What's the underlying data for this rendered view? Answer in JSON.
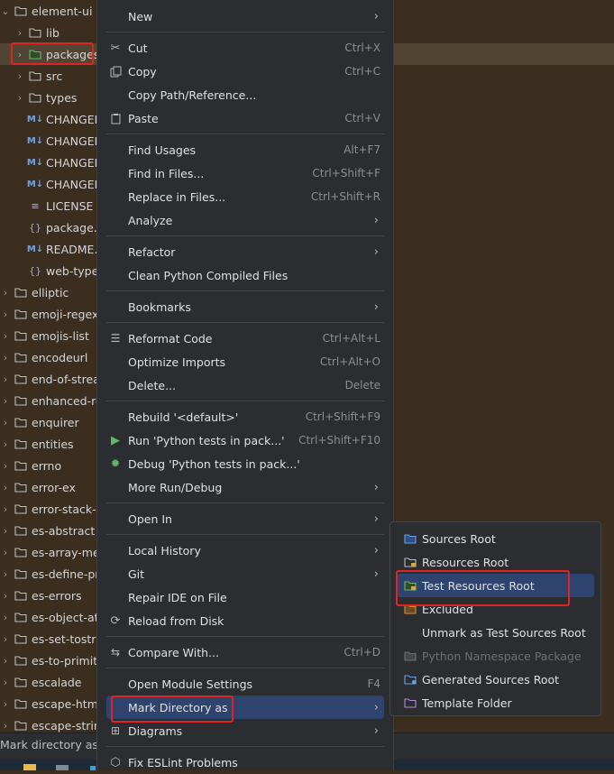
{
  "project_tree": {
    "items": [
      {
        "label": "element-ui",
        "icon": "folder-icon",
        "chevron": "down",
        "level": 0
      },
      {
        "label": "lib",
        "icon": "folder-icon",
        "chevron": "right",
        "level": 1
      },
      {
        "label": "packages",
        "icon": "folder-green-icon",
        "chevron": "right",
        "level": 1
      },
      {
        "label": "src",
        "icon": "folder-icon",
        "chevron": "right",
        "level": 1
      },
      {
        "label": "types",
        "icon": "folder-icon",
        "chevron": "right",
        "level": 1
      },
      {
        "label": "CHANGELOG.en-US.md",
        "icon": "markdown-icon",
        "level": 1
      },
      {
        "label": "CHANGELOG.es.md",
        "icon": "markdown-icon",
        "level": 1
      },
      {
        "label": "CHANGELOG.fr-FR.md",
        "icon": "markdown-icon",
        "level": 1
      },
      {
        "label": "CHANGELOG.zh-CN.md",
        "icon": "markdown-icon",
        "level": 1
      },
      {
        "label": "LICENSE",
        "icon": "text-file-icon",
        "level": 1
      },
      {
        "label": "package.json",
        "icon": "json-icon",
        "level": 1
      },
      {
        "label": "README.md",
        "icon": "markdown-icon",
        "level": 1
      },
      {
        "label": "web-types.json",
        "icon": "json-icon",
        "level": 1
      },
      {
        "label": "elliptic",
        "icon": "folder-icon",
        "chevron": "right",
        "level": 0
      },
      {
        "label": "emoji-regex",
        "icon": "folder-icon",
        "chevron": "right",
        "level": 0
      },
      {
        "label": "emojis-list",
        "icon": "folder-icon",
        "chevron": "right",
        "level": 0
      },
      {
        "label": "encodeurl",
        "icon": "folder-icon",
        "chevron": "right",
        "level": 0
      },
      {
        "label": "end-of-stream",
        "icon": "folder-icon",
        "chevron": "right",
        "level": 0
      },
      {
        "label": "enhanced-resolve",
        "icon": "folder-icon",
        "chevron": "right",
        "level": 0
      },
      {
        "label": "enquirer",
        "icon": "folder-icon",
        "chevron": "right",
        "level": 0
      },
      {
        "label": "entities",
        "icon": "folder-icon",
        "chevron": "right",
        "level": 0
      },
      {
        "label": "errno",
        "icon": "folder-icon",
        "chevron": "right",
        "level": 0
      },
      {
        "label": "error-ex",
        "icon": "folder-icon",
        "chevron": "right",
        "level": 0
      },
      {
        "label": "error-stack-parser",
        "icon": "folder-icon",
        "chevron": "right",
        "level": 0
      },
      {
        "label": "es-abstract",
        "icon": "folder-icon",
        "chevron": "right",
        "level": 0
      },
      {
        "label": "es-array-method-boxes-properly",
        "icon": "folder-icon",
        "chevron": "right",
        "level": 0
      },
      {
        "label": "es-define-property",
        "icon": "folder-icon",
        "chevron": "right",
        "level": 0
      },
      {
        "label": "es-errors",
        "icon": "folder-icon",
        "chevron": "right",
        "level": 0
      },
      {
        "label": "es-object-atoms",
        "icon": "folder-icon",
        "chevron": "right",
        "level": 0
      },
      {
        "label": "es-set-tostringtag",
        "icon": "folder-icon",
        "chevron": "right",
        "level": 0
      },
      {
        "label": "es-to-primitive",
        "icon": "folder-icon",
        "chevron": "right",
        "level": 0
      },
      {
        "label": "escalade",
        "icon": "folder-icon",
        "chevron": "right",
        "level": 0
      },
      {
        "label": "escape-html",
        "icon": "folder-icon",
        "chevron": "right",
        "level": 0
      },
      {
        "label": "escape-string-regexp",
        "icon": "folder-icon",
        "chevron": "right",
        "level": 0
      }
    ]
  },
  "context_menu": {
    "groups": [
      [
        {
          "label": "New",
          "submenu": true
        }
      ],
      [
        {
          "label": "Cut",
          "icon": "scissors-icon",
          "shortcut": "Ctrl+X"
        },
        {
          "label": "Copy",
          "icon": "copy-icon",
          "shortcut": "Ctrl+C"
        },
        {
          "label": "Copy Path/Reference..."
        },
        {
          "label": "Paste",
          "icon": "paste-icon",
          "shortcut": "Ctrl+V"
        }
      ],
      [
        {
          "label": "Find Usages",
          "shortcut": "Alt+F7"
        },
        {
          "label": "Find in Files...",
          "shortcut": "Ctrl+Shift+F"
        },
        {
          "label": "Replace in Files...",
          "shortcut": "Ctrl+Shift+R"
        },
        {
          "label": "Analyze",
          "submenu": true
        }
      ],
      [
        {
          "label": "Refactor",
          "submenu": true
        },
        {
          "label": "Clean Python Compiled Files"
        }
      ],
      [
        {
          "label": "Bookmarks",
          "submenu": true
        }
      ],
      [
        {
          "label": "Reformat Code",
          "icon": "reformat-icon",
          "shortcut": "Ctrl+Alt+L"
        },
        {
          "label": "Optimize Imports",
          "shortcut": "Ctrl+Alt+O"
        },
        {
          "label": "Delete...",
          "shortcut": "Delete"
        }
      ],
      [
        {
          "label": "Rebuild '<default>'",
          "shortcut": "Ctrl+Shift+F9"
        },
        {
          "label": "Run 'Python tests in pack...'",
          "icon": "run-icon",
          "shortcut": "Ctrl+Shift+F10"
        },
        {
          "label": "Debug 'Python tests in pack...'",
          "icon": "debug-icon"
        },
        {
          "label": "More Run/Debug",
          "submenu": true
        }
      ],
      [
        {
          "label": "Open In",
          "submenu": true
        }
      ],
      [
        {
          "label": "Local History",
          "submenu": true
        },
        {
          "label": "Git",
          "submenu": true
        },
        {
          "label": "Repair IDE on File"
        },
        {
          "label": "Reload from Disk",
          "icon": "reload-icon"
        }
      ],
      [
        {
          "label": "Compare With...",
          "icon": "compare-icon",
          "shortcut": "Ctrl+D"
        }
      ],
      [
        {
          "label": "Open Module Settings",
          "shortcut": "F4"
        },
        {
          "label": "Mark Directory as",
          "submenu": true,
          "selected": true
        },
        {
          "label": "Diagrams",
          "icon": "diagram-icon",
          "submenu": true
        }
      ],
      [
        {
          "label": "Fix ESLint Problems",
          "icon": "eslint-icon"
        }
      ]
    ]
  },
  "submenu": {
    "items": [
      {
        "label": "Sources Root",
        "icon": "folder-blue-icon"
      },
      {
        "label": "Resources Root",
        "icon": "resources-folder-icon"
      },
      {
        "label": "Test Resources Root",
        "icon": "test-resources-folder-icon",
        "selected": true
      },
      {
        "label": "Excluded",
        "icon": "folder-orange-icon"
      },
      {
        "label": "Unmark as Test Sources Root"
      },
      {
        "label": "Python Namespace Package",
        "icon": "folder-gray-icon",
        "disabled": true
      },
      {
        "label": "Generated Sources Root",
        "icon": "generated-folder-icon"
      },
      {
        "label": "Template Folder",
        "icon": "folder-purple-icon"
      }
    ]
  },
  "status_bar": {
    "text": "Mark directory as a test resources root"
  },
  "colors": {
    "background": "#3b2e1e",
    "menu_background": "#2b2d30",
    "selection": "#2e436e",
    "annotation": "#e02424"
  }
}
